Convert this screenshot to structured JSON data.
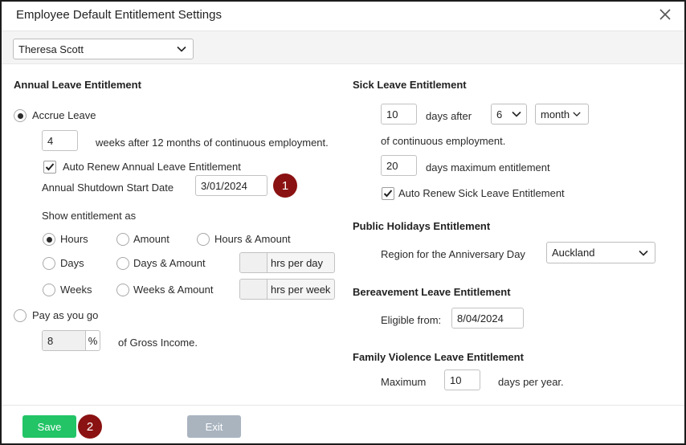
{
  "dialog": {
    "title": "Employee Default Entitlement Settings",
    "close_icon": "close-icon"
  },
  "employee_select": {
    "value": "Theresa Scott"
  },
  "annual": {
    "heading": "Annual Leave Entitlement",
    "accrue_label": "Accrue Leave",
    "weeks_value": "4",
    "weeks_text": "weeks after 12 months of continuous employment.",
    "auto_renew_label": "Auto Renew Annual Leave Entitlement",
    "shutdown_label": "Annual Shutdown Start Date",
    "shutdown_value": "3/01/2024",
    "show_as_label": "Show entitlement as",
    "options": {
      "hours": "Hours",
      "amount": "Amount",
      "hours_amount": "Hours & Amount",
      "days": "Days",
      "days_amount": "Days & Amount",
      "weeks": "Weeks",
      "weeks_amount": "Weeks & Amount"
    },
    "hrs_per_day": "hrs per day",
    "hrs_per_week": "hrs per week",
    "payg_label": "Pay as you go",
    "payg_value": "8",
    "percent": "%",
    "gross_text": "of Gross Income."
  },
  "sick": {
    "heading": "Sick Leave Entitlement",
    "days_value": "10",
    "days_after": "days after",
    "period_value": "6",
    "unit_value": "month",
    "continuous_text": "of continuous employment.",
    "max_value": "20",
    "max_text": "days maximum entitlement",
    "auto_renew_label": "Auto Renew Sick Leave Entitlement"
  },
  "public_holidays": {
    "heading": "Public Holidays Entitlement",
    "region_label": "Region for the Anniversary Day",
    "region_value": "Auckland"
  },
  "bereavement": {
    "heading": "Bereavement Leave Entitlement",
    "eligible_label": "Eligible from:",
    "eligible_value": "8/04/2024"
  },
  "family_violence": {
    "heading": "Family Violence Leave Entitlement",
    "maximum_label": "Maximum",
    "maximum_value": "10",
    "days_per_year": "days per year."
  },
  "footer": {
    "save_label": "Save",
    "exit_label": "Exit"
  },
  "badges": {
    "one": "1",
    "two": "2"
  },
  "colors": {
    "save": "#22c466",
    "exit": "#a9b4bf",
    "badge": "#8b1212"
  }
}
